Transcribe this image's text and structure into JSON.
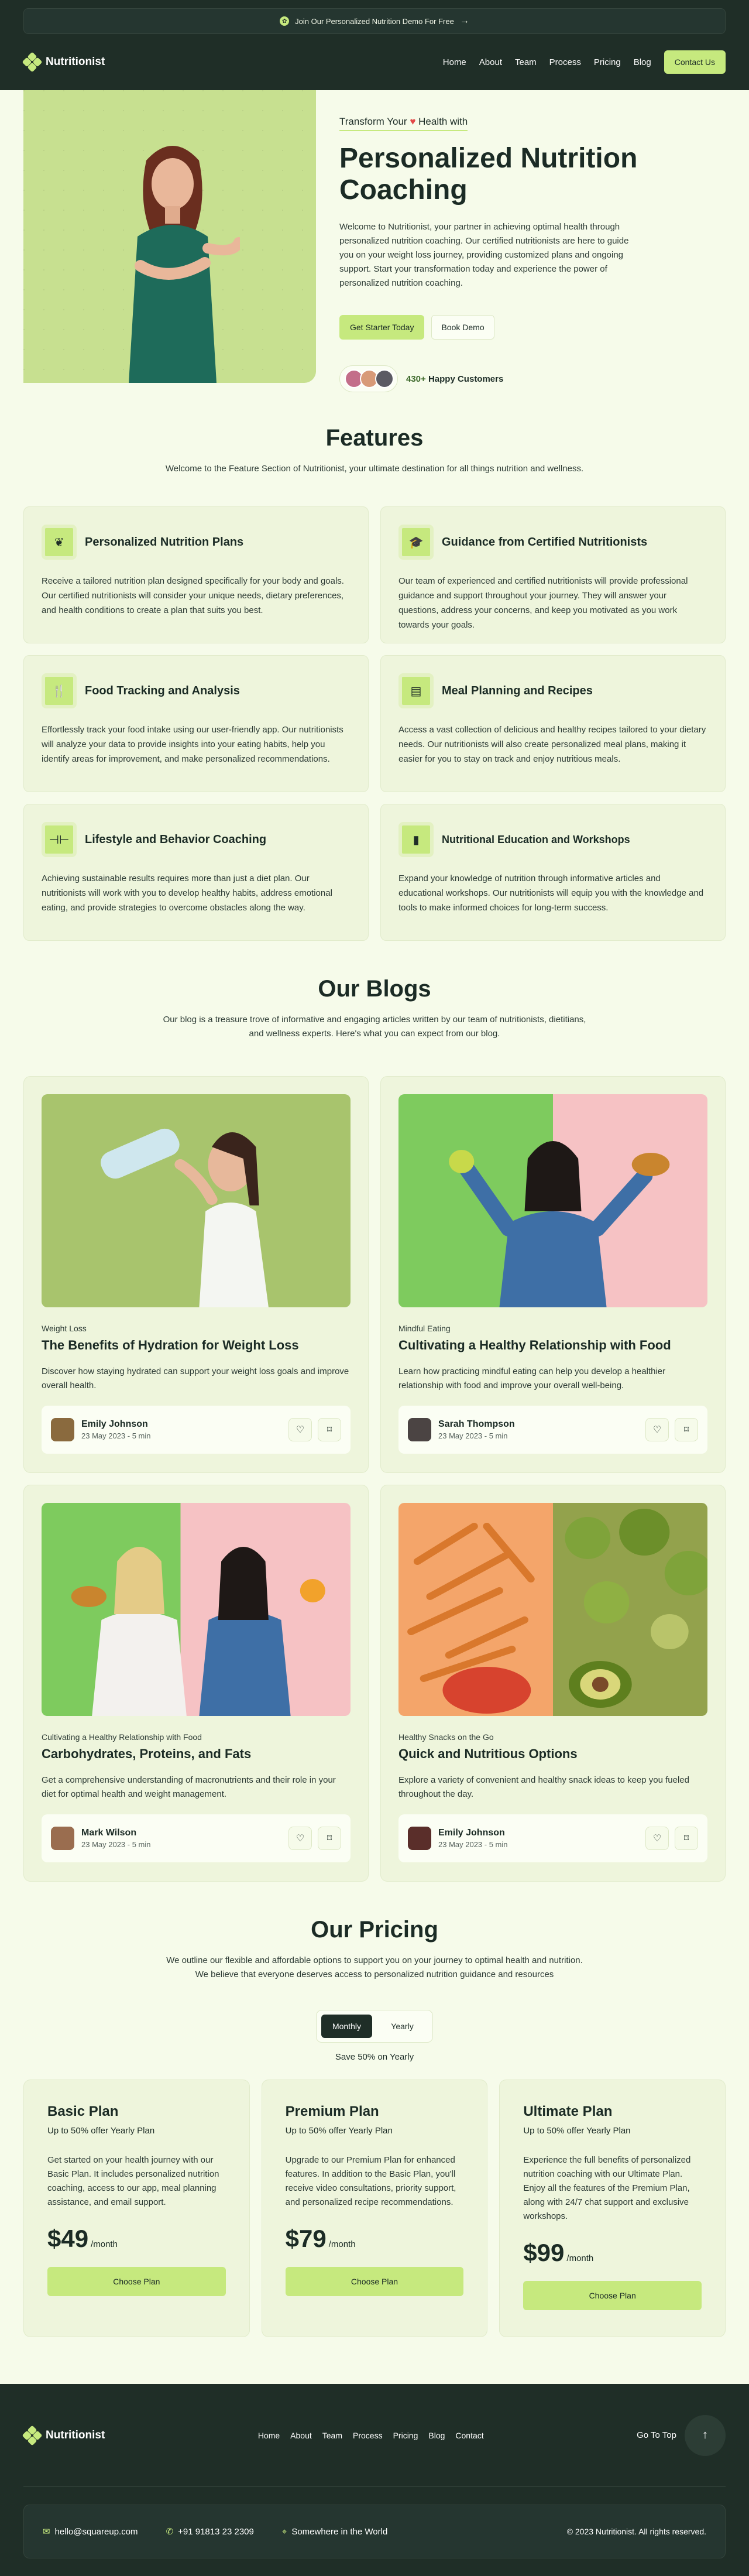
{
  "banner": {
    "text": "Join Our Personalized Nutrition Demo For Free"
  },
  "nav": {
    "logo": "Nutritionist",
    "links": [
      "Home",
      "About",
      "Team",
      "Process",
      "Pricing",
      "Blog"
    ],
    "cta": "Contact Us"
  },
  "hero": {
    "tagline_before": "Transform Your",
    "tagline_after": "Health with",
    "title": "Personalized Nutrition Coaching",
    "description": "Welcome to Nutritionist, your partner in achieving optimal health through personalized nutrition coaching. Our certified nutritionists are here to guide you on your weight loss journey, providing customized plans and ongoing support. Start your transformation today and experience the power of personalized nutrition coaching.",
    "primary_button": "Get Starter Today",
    "secondary_button": "Book Demo",
    "customers_count": "430+",
    "customers_label": "Happy Customers"
  },
  "features": {
    "title": "Features",
    "subtitle": "Welcome to the Feature Section of Nutritionist, your ultimate destination for all things nutrition and wellness.",
    "items": [
      {
        "icon": "leaf-icon",
        "title": "Personalized Nutrition Plans",
        "desc": "Receive a tailored nutrition plan designed specifically for your body and goals. Our certified nutritionists will consider your unique needs, dietary preferences, and health conditions to create a plan that suits you best."
      },
      {
        "icon": "graduation-cap-icon",
        "title": "Guidance from Certified Nutritionists",
        "desc": "Our team of experienced and certified nutritionists will provide professional guidance and support throughout your journey. They will answer your questions, address your concerns, and keep you motivated as you work towards your goals."
      },
      {
        "icon": "fork-knife-icon",
        "title": "Food Tracking and Analysis",
        "desc": "Effortlessly track your food intake using our user-friendly app. Our nutritionists will analyze your data to provide insights into your eating habits, help you identify areas for improvement, and make personalized recommendations."
      },
      {
        "icon": "clipboard-icon",
        "title": "Meal Planning and Recipes",
        "desc": "Access a vast collection of delicious and healthy recipes tailored to your dietary needs. Our nutritionists will also create personalized meal plans, making it easier for you to stay on track and enjoy nutritious meals."
      },
      {
        "icon": "dumbbell-icon",
        "title": "Lifestyle and Behavior Coaching",
        "desc": "Achieving sustainable results requires more than just a diet plan. Our nutritionists will work with you to develop healthy habits, address emotional eating, and provide strategies to overcome obstacles along the way."
      },
      {
        "icon": "jar-icon",
        "title": "Nutritional Education and Workshops",
        "desc": "Expand your knowledge of nutrition through informative articles and educational workshops. Our nutritionists will equip you with the knowledge and tools to make informed choices for long-term success."
      }
    ]
  },
  "blogs": {
    "title": "Our Blogs",
    "subtitle_1": "Our blog is a treasure trove of informative and engaging articles written by our team of nutritionists, dietitians,",
    "subtitle_2": "and wellness experts. Here's what you can expect from our blog.",
    "posts": [
      {
        "category": "Weight Loss",
        "title": "The Benefits of Hydration for Weight Loss",
        "desc": "Discover how staying hydrated can support your weight loss goals and improve overall health.",
        "author": "Emily Johnson",
        "date": "23 May 2023 - 5 min"
      },
      {
        "category": "Mindful Eating",
        "title": "Cultivating a Healthy Relationship with Food",
        "desc": "Learn how practicing mindful eating can help you develop a healthier relationship with food and improve your overall well-being.",
        "author": "Sarah Thompson",
        "date": "23 May 2023 - 5 min"
      },
      {
        "category": "Cultivating a Healthy Relationship with Food",
        "title": "Carbohydrates, Proteins, and Fats",
        "desc": "Get a comprehensive understanding of macronutrients and their role in your diet for optimal health and weight management.",
        "author": "Mark Wilson",
        "date": "23 May 2023 - 5 min"
      },
      {
        "category": "Healthy Snacks on the Go",
        "title": "Quick and Nutritious Options",
        "desc": "Explore a variety of convenient and healthy snack ideas to keep you fueled throughout the day.",
        "author": "Emily Johnson",
        "date": "23 May 2023 - 5 min"
      }
    ]
  },
  "pricing": {
    "title": "Our Pricing",
    "subtitle_1": "We outline our flexible and affordable options to support you on your journey to optimal health and nutrition.",
    "subtitle_2": "We believe that everyone deserves access to personalized nutrition guidance and resources",
    "toggle_monthly": "Monthly",
    "toggle_yearly": "Yearly",
    "save_text": "Save 50% on Yearly",
    "plans": [
      {
        "name": "Basic Plan",
        "off": "Up to 50% offer Yearly Plan",
        "desc": "Get started on your health journey with our Basic Plan. It includes personalized nutrition coaching, access to our app, meal planning assistance, and email support.",
        "price": "$49",
        "per": "/month",
        "button": "Choose Plan"
      },
      {
        "name": "Premium Plan",
        "off": "Up to 50% offer Yearly Plan",
        "desc": "Upgrade to our Premium Plan for enhanced features. In addition to the Basic Plan, you'll receive video consultations, priority support, and personalized recipe recommendations.",
        "price": "$79",
        "per": "/month",
        "button": "Choose Plan"
      },
      {
        "name": "Ultimate Plan",
        "off": "Up to 50% offer Yearly Plan",
        "desc": "Experience the full benefits of personalized nutrition coaching with our Ultimate Plan. Enjoy all the features of the Premium Plan, along with 24/7 chat support and exclusive workshops.",
        "price": "$99",
        "per": "/month",
        "button": "Choose Plan"
      }
    ]
  },
  "footer": {
    "logo": "Nutritionist",
    "links": [
      "Home",
      "About",
      "Team",
      "Process",
      "Pricing",
      "Blog",
      "Contact"
    ],
    "top_label": "Go To Top",
    "email": "hello@squareup.com",
    "phone": "+91 91813 23 2309",
    "location": "Somewhere in the World",
    "copyright": "© 2023 Nutritionist. All rights reserved."
  },
  "colors": {
    "accent": "#C6E97E",
    "dark": "#1F2E27",
    "background": "#F6FBEA",
    "card": "#EEF5DC"
  }
}
